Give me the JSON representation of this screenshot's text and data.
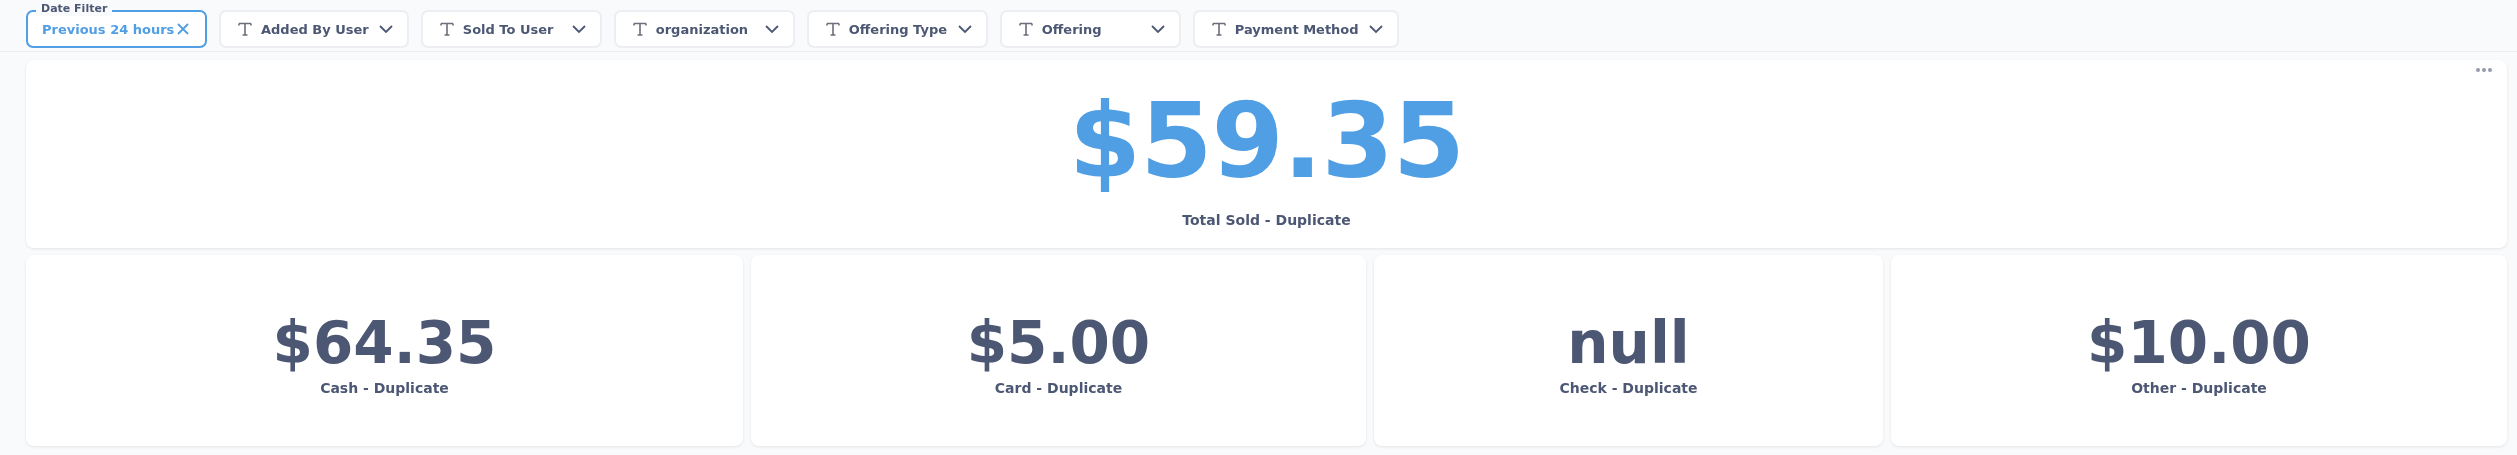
{
  "filters": [
    {
      "kind": "date",
      "legend": "Date Filter",
      "value": "Previous 24 hours"
    },
    {
      "kind": "text",
      "label": "Added By User"
    },
    {
      "kind": "text",
      "label": "Sold To User"
    },
    {
      "kind": "text",
      "label": "organization"
    },
    {
      "kind": "text",
      "label": "Offering Type"
    },
    {
      "kind": "text",
      "label": "Offering"
    },
    {
      "kind": "text",
      "label": "Payment Method"
    }
  ],
  "cards": [
    {
      "kind": "hero",
      "value": "$59.35",
      "label": "Total Sold - Duplicate"
    },
    {
      "kind": "stat",
      "value": "$64.35",
      "label": "Cash - Duplicate"
    },
    {
      "kind": "stat",
      "value": "$5.00",
      "label": "Card - Duplicate"
    },
    {
      "kind": "stat",
      "value": "null",
      "label": "Check - Duplicate"
    },
    {
      "kind": "stat",
      "value": "$10.00",
      "label": "Other - Duplicate"
    }
  ]
}
